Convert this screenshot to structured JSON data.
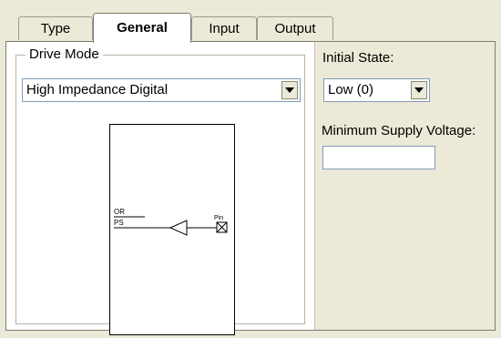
{
  "tabs": [
    {
      "label": "Type"
    },
    {
      "label": "General"
    },
    {
      "label": "Input"
    },
    {
      "label": "Output"
    }
  ],
  "drive_mode": {
    "group_label": "Drive Mode",
    "selected": "High Impedance Digital"
  },
  "diagram": {
    "signal_or": "OR",
    "signal_ps": "PS",
    "pin_label": "Pin"
  },
  "initial_state": {
    "label": "Initial State:",
    "selected": "Low (0)"
  },
  "min_supply_voltage": {
    "label": "Minimum Supply Voltage:",
    "value": ""
  },
  "colors": {
    "dialog_bg": "#ece9d8",
    "panel_bg": "#ffffff",
    "border": "#7f7d72"
  }
}
